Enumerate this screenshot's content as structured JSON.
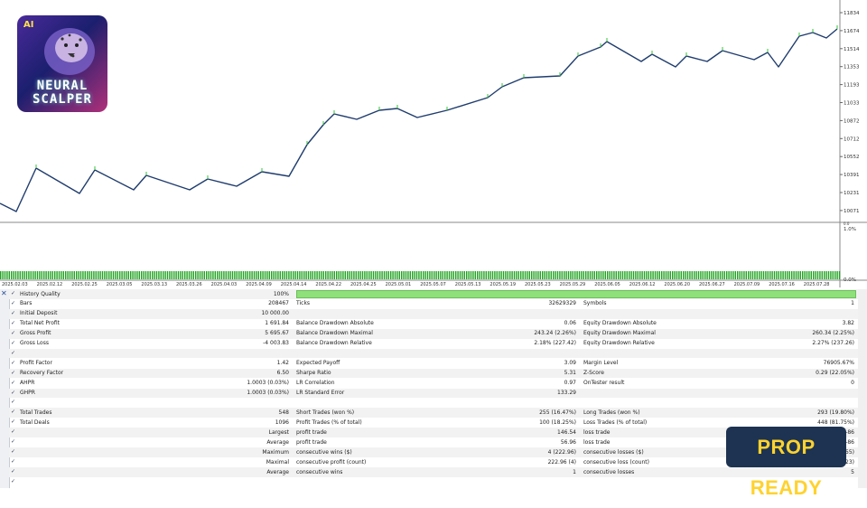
{
  "logo": {
    "ai_badge": "AI",
    "line1": "NEURAL",
    "line2": "SCALPER"
  },
  "badge": {
    "text": "PROP READY"
  },
  "chart": {
    "price_ticks": [
      "11834",
      "11674",
      "11514",
      "11353",
      "11193",
      "11033",
      "10872",
      "10712",
      "10552",
      "10391",
      "10231",
      "10071"
    ],
    "indicator_label": "Balance / Equity / Every tick / Every tick based on real ticks",
    "indicator_ticks": [
      "1.0%",
      "0.0%"
    ],
    "dates": [
      "2025.02.03",
      "2025.02.12",
      "2025.02.25",
      "2025.03.05",
      "2025.03.13",
      "2025.03.26",
      "2025.04.03",
      "2025.04.09",
      "2025.04.14",
      "2025.04.22",
      "2025.04.25",
      "2025.05.01",
      "2025.05.07",
      "2025.05.13",
      "2025.05.19",
      "2025.05.23",
      "2025.05.29",
      "2025.06.05",
      "2025.06.12",
      "2025.06.20",
      "2025.06.27",
      "2025.07.09",
      "2025.07.16",
      "2025.07.28"
    ]
  },
  "table": {
    "close_icon": "✕",
    "quality_bar_color": "#8fe07a",
    "rows": [
      {
        "l1": "History Quality",
        "v1": "100%",
        "l2": "",
        "v2": "",
        "l3": "",
        "v3": "",
        "bar": true
      },
      {
        "l1": "Bars",
        "v1": "208467",
        "l2": "Ticks",
        "v2": "32629329",
        "l3": "Symbols",
        "v3": "1"
      },
      {
        "l1": "Initial Deposit",
        "v1": "10 000.00",
        "l2": "",
        "v2": "",
        "l3": "",
        "v3": ""
      },
      {
        "l1": "Total Net Profit",
        "v1": "1 691.84",
        "l2": "Balance Drawdown Absolute",
        "v2": "0.06",
        "l3": "Equity Drawdown Absolute",
        "v3": "3.82"
      },
      {
        "l1": "Gross Profit",
        "v1": "5 695.67",
        "l2": "Balance Drawdown Maximal",
        "v2": "243.24 (2.26%)",
        "l3": "Equity Drawdown Maximal",
        "v3": "260.34 (2.25%)"
      },
      {
        "l1": "Gross Loss",
        "v1": "-4 003.83",
        "l2": "Balance Drawdown Relative",
        "v2": "2.18% (227.42)",
        "l3": "Equity Drawdown Relative",
        "v3": "2.27% (237.26)"
      },
      {
        "l1": "",
        "v1": "",
        "l2": "",
        "v2": "",
        "l3": "",
        "v3": ""
      },
      {
        "l1": "Profit Factor",
        "v1": "1.42",
        "l2": "Expected Payoff",
        "v2": "3.09",
        "l3": "Margin Level",
        "v3": "76905.67%"
      },
      {
        "l1": "Recovery Factor",
        "v1": "6.50",
        "l2": "Sharpe Ratio",
        "v2": "5.31",
        "l3": "Z-Score",
        "v3": "0.29 (22.05%)"
      },
      {
        "l1": "AHPR",
        "v1": "1.0003 (0.03%)",
        "l2": "LR Correlation",
        "v2": "0.97",
        "l3": "OnTester result",
        "v3": "0"
      },
      {
        "l1": "GHPR",
        "v1": "1.0003 (0.03%)",
        "l2": "LR Standard Error",
        "v2": "133.29",
        "l3": "",
        "v3": ""
      },
      {
        "l1": "",
        "v1": "",
        "l2": "",
        "v2": "",
        "l3": "",
        "v3": ""
      },
      {
        "l1": "Total Trades",
        "v1": "548",
        "l2": "Short Trades (won %)",
        "v2": "255 (16.47%)",
        "l3": "Long Trades (won %)",
        "v3": "293 (19.80%)"
      },
      {
        "l1": "Total Deals",
        "v1": "1096",
        "l2": "Profit Trades (% of total)",
        "v2": "100 (18.25%)",
        "l3": "Loss Trades (% of total)",
        "v3": "448 (81.75%)"
      },
      {
        "l1": "",
        "v1": "Largest",
        "l2": "profit trade",
        "v2": "146.54",
        "l3": "loss trade",
        "v3": "-86"
      },
      {
        "l1": "",
        "v1": "Average",
        "l2": "profit trade",
        "v2": "56.96",
        "l3": "loss trade",
        "v3": "-86"
      },
      {
        "l1": "",
        "v1": "Maximum",
        "l2": "consecutive wins ($)",
        "v2": "4 (222.96)",
        "l3": "consecutive losses ($)",
        "v3": "(55)"
      },
      {
        "l1": "",
        "v1": "Maximal",
        "l2": "consecutive profit (count)",
        "v2": "222.96 (4)",
        "l3": "consecutive loss (count)",
        "v3": "(23)"
      },
      {
        "l1": "",
        "v1": "Average",
        "l2": "consecutive wins",
        "v2": "1",
        "l3": "consecutive losses",
        "v3": "5"
      },
      {
        "l1": "",
        "v1": "",
        "l2": "",
        "v2": "",
        "l3": "",
        "v3": ""
      }
    ]
  }
}
